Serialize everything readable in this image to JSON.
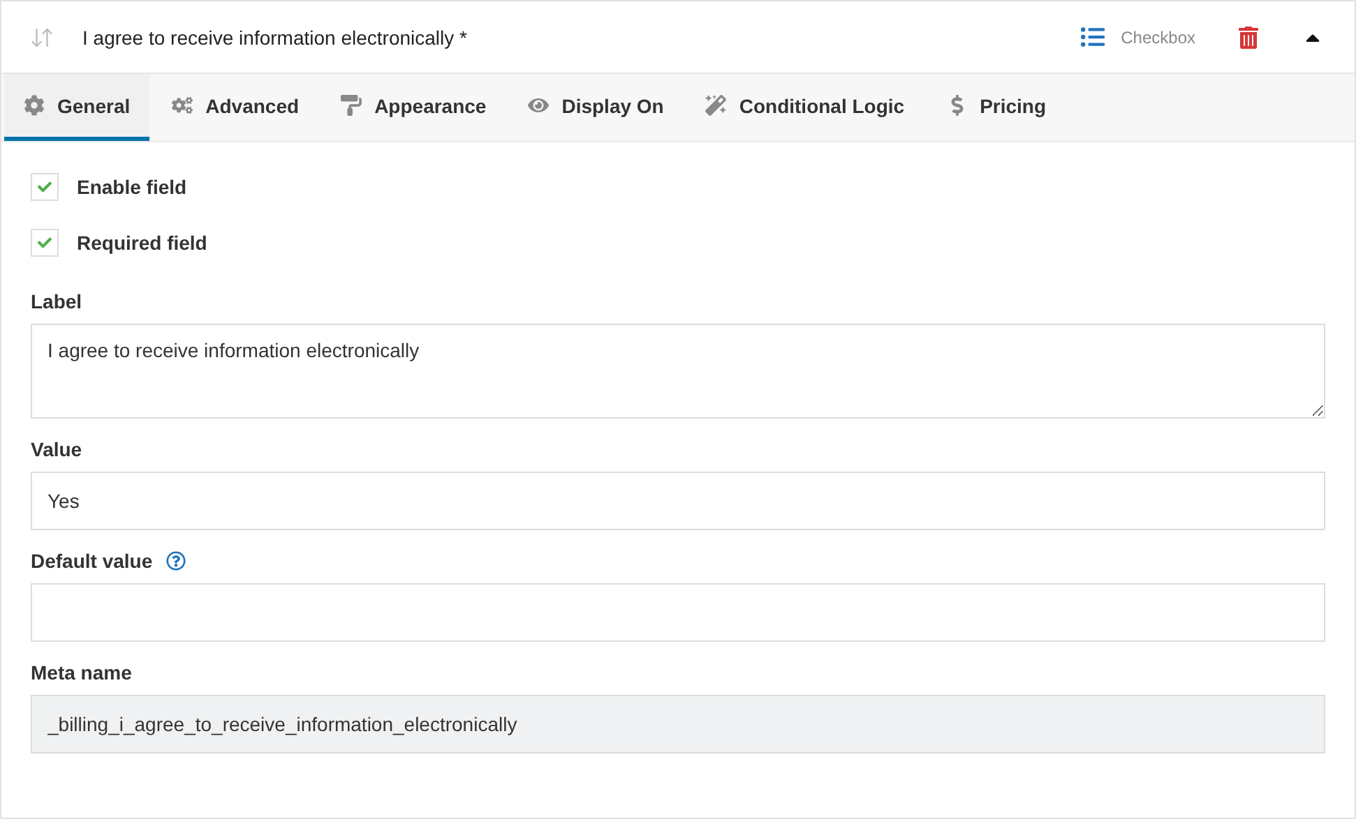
{
  "header": {
    "title": "I agree to receive information electronically *",
    "type_label": "Checkbox",
    "expanded": true
  },
  "tabs": [
    {
      "label": "General",
      "selected": true
    },
    {
      "label": "Advanced",
      "selected": false
    },
    {
      "label": "Appearance",
      "selected": false
    },
    {
      "label": "Display On",
      "selected": false
    },
    {
      "label": "Conditional Logic",
      "selected": false
    },
    {
      "label": "Pricing",
      "selected": false
    }
  ],
  "options": [
    {
      "label": "Enable field",
      "checked": true
    },
    {
      "label": "Required field",
      "checked": true
    }
  ],
  "fields": [
    {
      "kind": "textarea",
      "label": "Label",
      "value": "I agree to receive information electronically",
      "help": false,
      "disabled": false
    },
    {
      "kind": "text",
      "label": "Value",
      "value": "Yes",
      "help": false,
      "disabled": false
    },
    {
      "kind": "text",
      "label": "Default value",
      "help": true,
      "disabled": false
    },
    {
      "kind": "text",
      "label": "Meta name",
      "value": "_billing_i_agree_to_receive_information_electronically",
      "help": false,
      "disabled": true
    }
  ]
}
